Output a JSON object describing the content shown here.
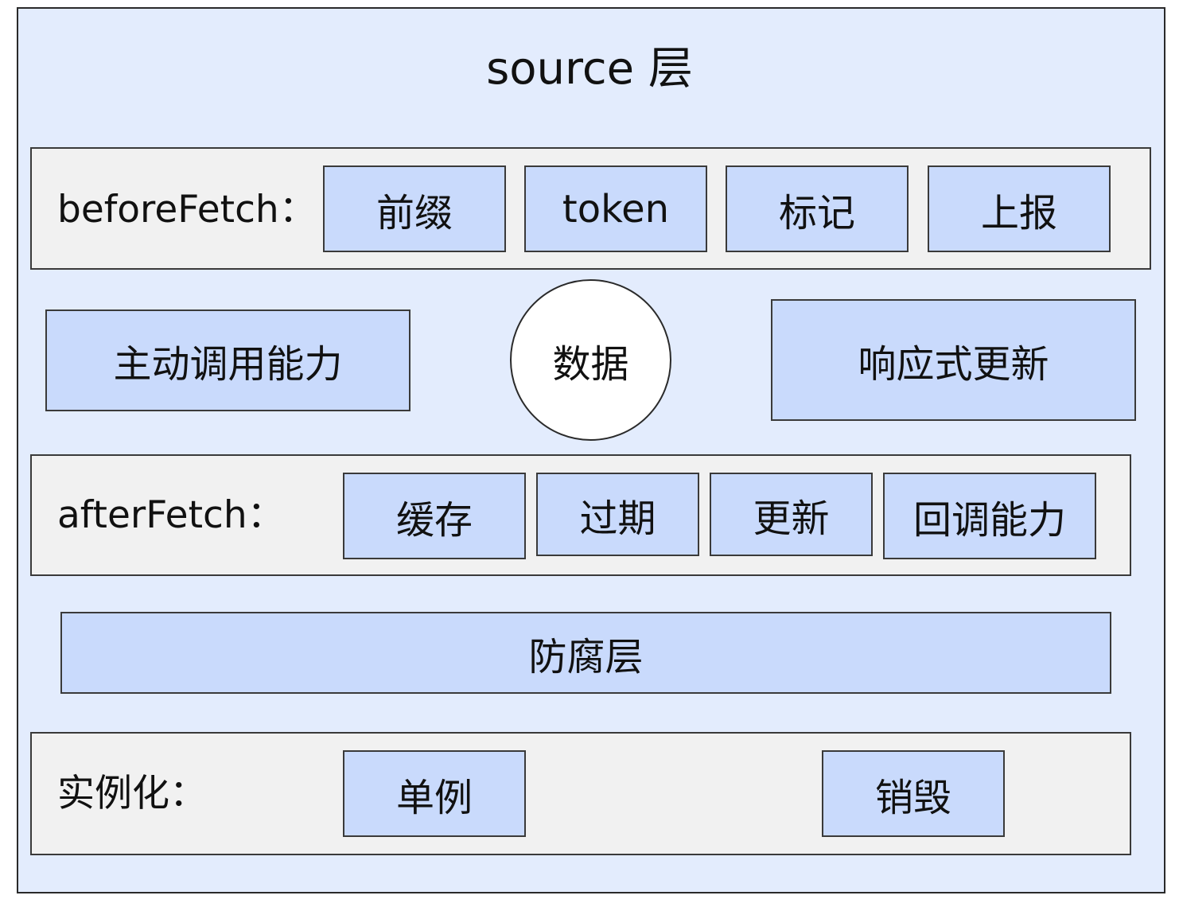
{
  "title": "source 层",
  "before_fetch": {
    "label": "beforeFetch：",
    "items": [
      "前缀",
      "token",
      "标记",
      "上报"
    ]
  },
  "middle": {
    "left": "主动调用能力",
    "center": "数据",
    "right": "响应式更新"
  },
  "after_fetch": {
    "label": "afterFetch：",
    "items": [
      "缓存",
      "过期",
      "更新",
      "回调能力"
    ]
  },
  "anticorruption": "防腐层",
  "instantiation": {
    "label": "实例化：",
    "items": [
      "单例",
      "销毁"
    ]
  },
  "colors": {
    "background": "#e3ecfd",
    "row_fill": "#f1f1f1",
    "box_fill": "#c9dafc",
    "circle_fill": "#ffffff",
    "border": "#3a3a3a"
  }
}
